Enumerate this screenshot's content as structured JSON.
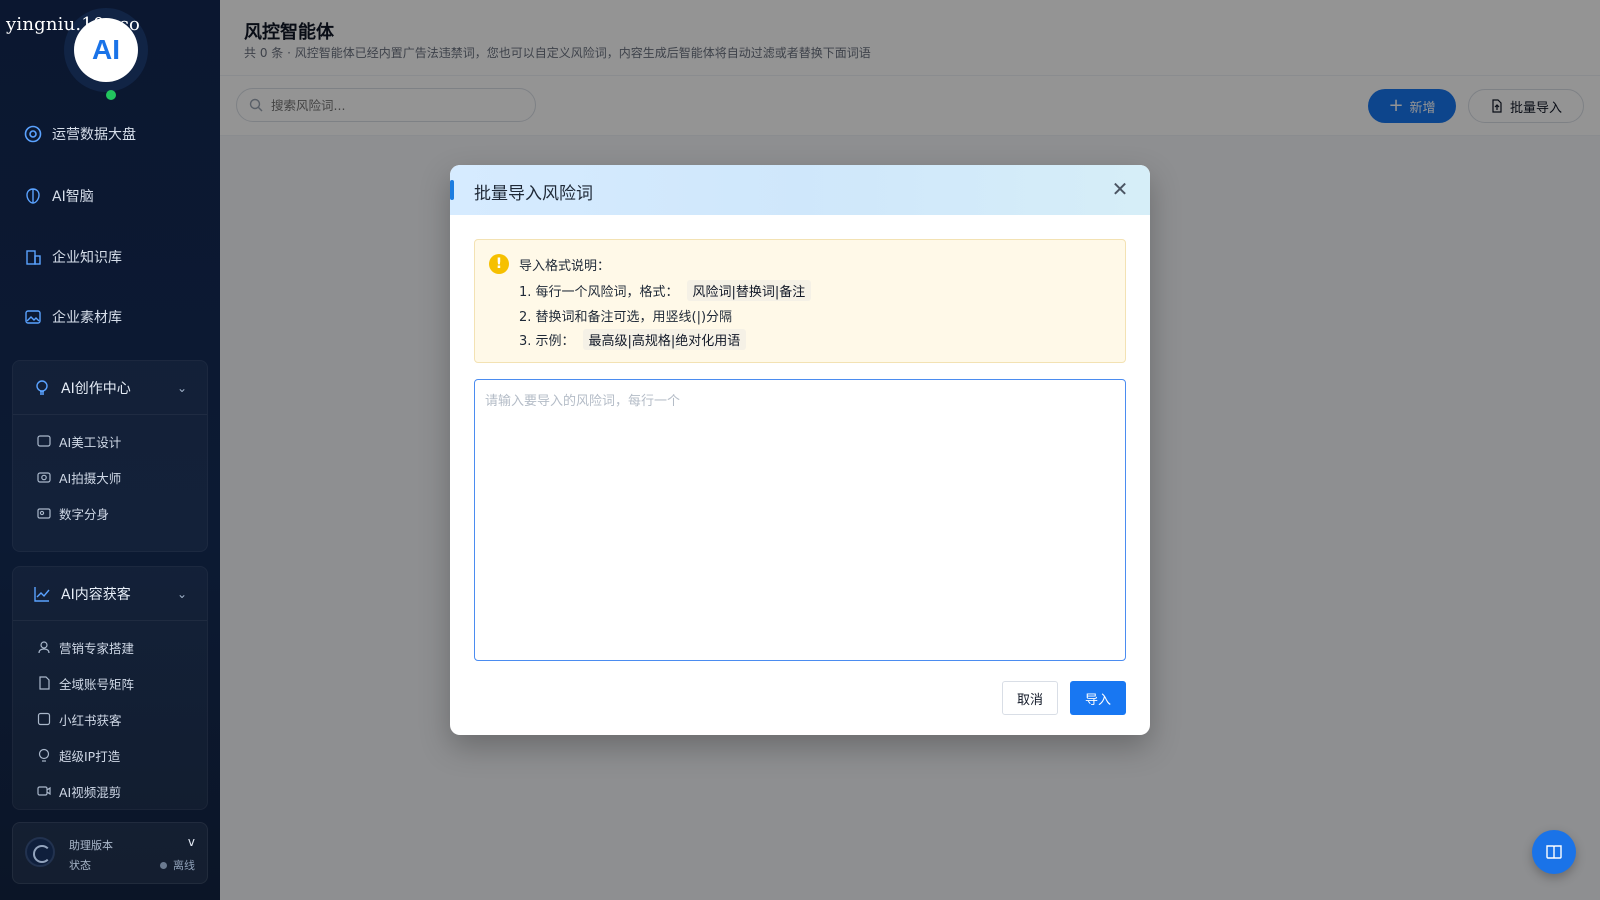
{
  "watermark": "yingniu.10v.co",
  "logo": {
    "text": "AI"
  },
  "sidebar": {
    "items": [
      {
        "label": "运营数据大盘",
        "icon": "dashboard-icon"
      },
      {
        "label": "AI智脑",
        "icon": "brain-icon"
      },
      {
        "label": "企业知识库",
        "icon": "building-icon"
      },
      {
        "label": "企业素材库",
        "icon": "image-icon"
      }
    ],
    "groups": [
      {
        "title": "AI创作中心",
        "icon": "lightbulb-icon",
        "items": [
          {
            "label": "AI美工设计",
            "icon": "design-icon"
          },
          {
            "label": "AI拍摄大师",
            "icon": "camera-icon"
          },
          {
            "label": "数字分身",
            "icon": "id-card-icon"
          }
        ]
      },
      {
        "title": "AI内容获客",
        "icon": "trend-chart-icon",
        "items": [
          {
            "label": "营销专家搭建",
            "icon": "user-icon"
          },
          {
            "label": "全域账号矩阵",
            "icon": "document-icon"
          },
          {
            "label": "小红书获客",
            "icon": "ai-badge-icon"
          },
          {
            "label": "超级IP打造",
            "icon": "ip-icon"
          },
          {
            "label": "AI视频混剪",
            "icon": "video-icon"
          }
        ]
      }
    ],
    "status": {
      "label_version": "助理版本",
      "label_state": "状态",
      "version": "v",
      "state": "离线"
    }
  },
  "header": {
    "title": "风控智能体",
    "subtitle": "共 0 条 · 风控智能体已经内置广告法违禁词，您也可以自定义风险词，内容生成后智能体将自动过滤或者替换下面词语"
  },
  "toolbar": {
    "search_placeholder": "搜索风险词...",
    "add_label": "新增",
    "import_label": "批量导入"
  },
  "modal": {
    "title": "批量导入风险词",
    "notice_title": "导入格式说明：",
    "line1_text": "1. 每行一个风险词，格式：",
    "line1_code": "风险词|替换词|备注",
    "line2_text": "2. 替换词和备注可选，用竖线(|)分隔",
    "line3_text": "3. 示例：",
    "line3_code": "最高级|高规格|绝对化用语",
    "textarea_placeholder": "请输入要导入的风险词，每行一个",
    "cancel_label": "取消",
    "confirm_label": "导入"
  },
  "colors": {
    "primary": "#1877f2",
    "sidebar_bg": "#0b1730",
    "online": "#22c55e",
    "warning": "#f6c000"
  }
}
